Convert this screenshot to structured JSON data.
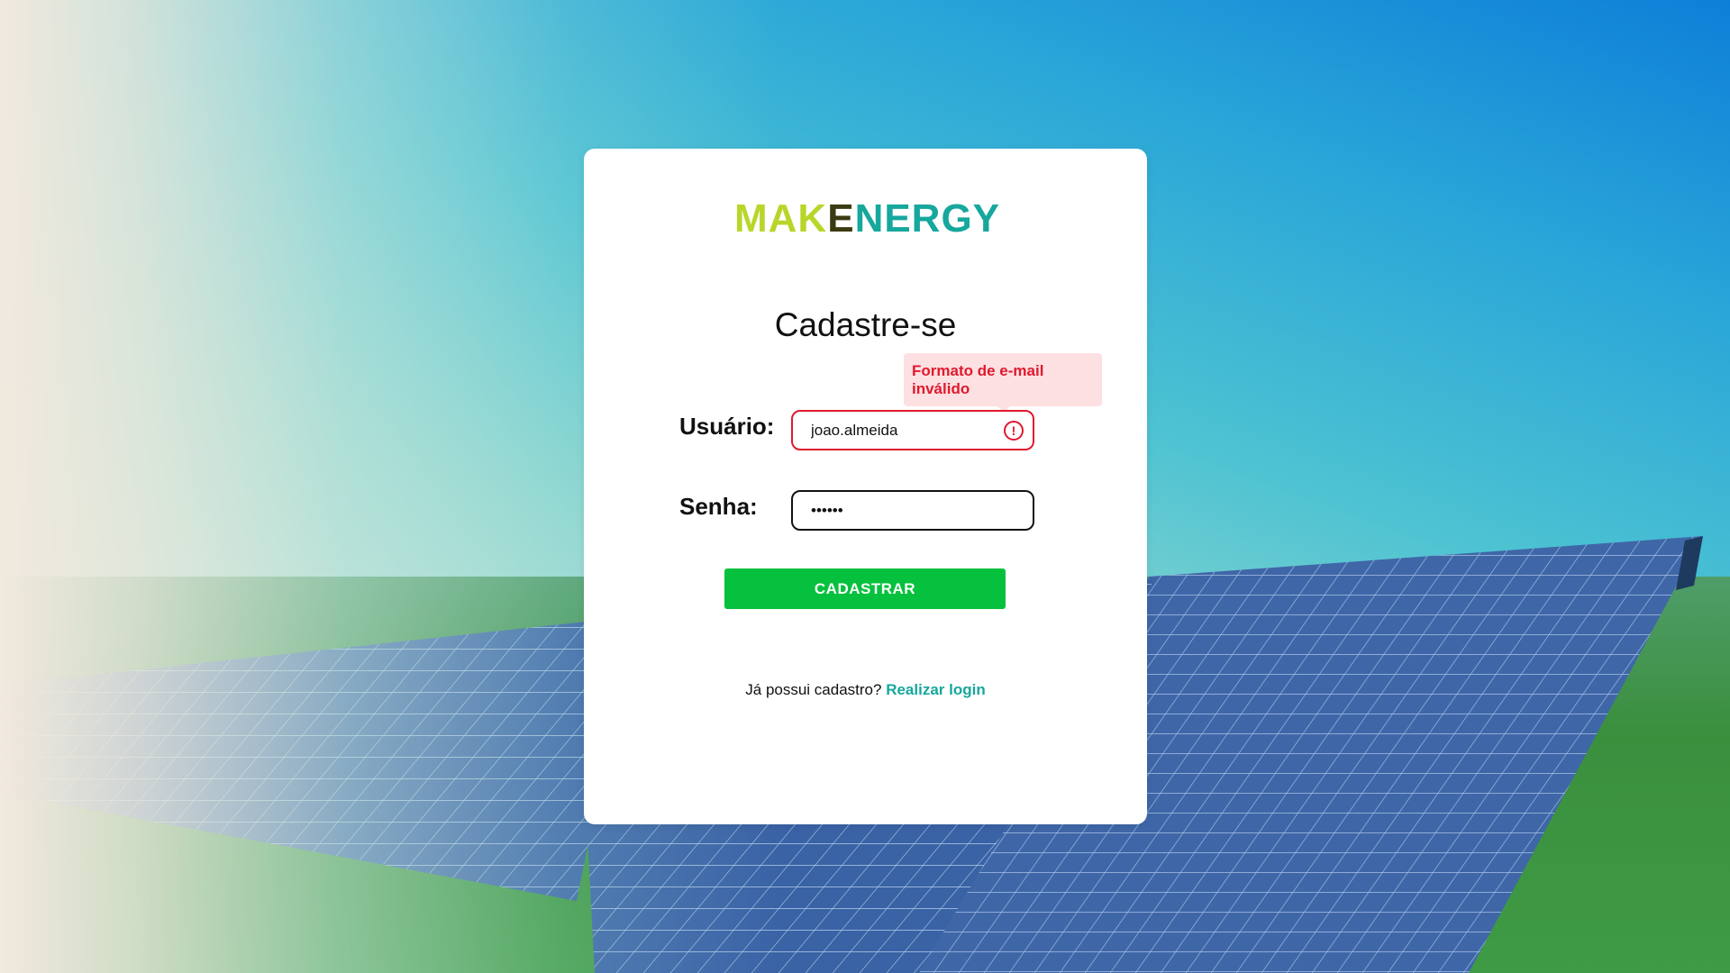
{
  "brand": {
    "logo_part1": "MAK",
    "logo_part2": "E",
    "logo_part3": "NERGY",
    "colors": {
      "green": "#b8d62a",
      "dark": "#3b3b12",
      "teal": "#16a79d"
    }
  },
  "form": {
    "title": "Cadastre-se",
    "username_label": "Usuário:",
    "username_value": "joao.almeida",
    "username_error": "Formato de e-mail inválido",
    "password_label": "Senha:",
    "password_value": "••••••",
    "submit_label": "CADASTRAR",
    "submit_color": "#06c13d",
    "error_color": "#e0192f"
  },
  "footer": {
    "question": "Já possui cadastro? ",
    "login_link": "Realizar login"
  },
  "background": {
    "icon": "solar-panels-photo"
  }
}
